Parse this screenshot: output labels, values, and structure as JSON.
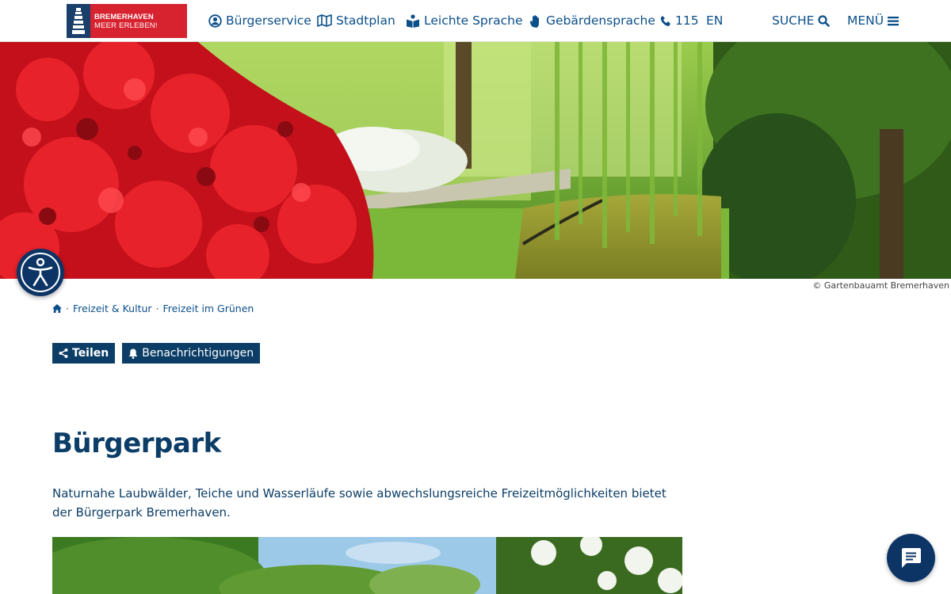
{
  "header": {
    "logo_line1": "BREMERHAVEN",
    "logo_line2": "MEER ERLEBEN!",
    "nav": {
      "buergerservice": "Bürgerservice",
      "stadtplan": "Stadtplan",
      "leichte_sprache": "Leichte Sprache",
      "gebaerdensprache": "Gebärdensprache",
      "phone": "115",
      "language": "EN",
      "search": "SUCHE",
      "menu": "MENÜ"
    }
  },
  "hero": {
    "credit": "© Gartenbauamt Bremerhaven"
  },
  "breadcrumb": {
    "sep": "·",
    "item1": "Freizeit & Kultur",
    "item2": "Freizeit im Grünen"
  },
  "actions": {
    "share": "Teilen",
    "notify": "Benachrichtigungen"
  },
  "content": {
    "title": "Bürgerpark",
    "intro": "Naturnahe Laubwälder, Teiche und Wasserläufe sowie abwechslungsreiche Freizeitmöglichkeiten bietet der Bürgerpark Bremerhaven."
  },
  "colors": {
    "brand_blue": "#0b3d66",
    "brand_red": "#d7222f",
    "link_blue": "#0b4f8a"
  },
  "icons": [
    "user-circle-icon",
    "map-icon",
    "book-icon",
    "hand-icon",
    "phone-icon",
    "search-icon",
    "hamburger-icon",
    "home-icon",
    "share-icon",
    "bell-icon",
    "accessibility-icon",
    "chat-icon"
  ]
}
